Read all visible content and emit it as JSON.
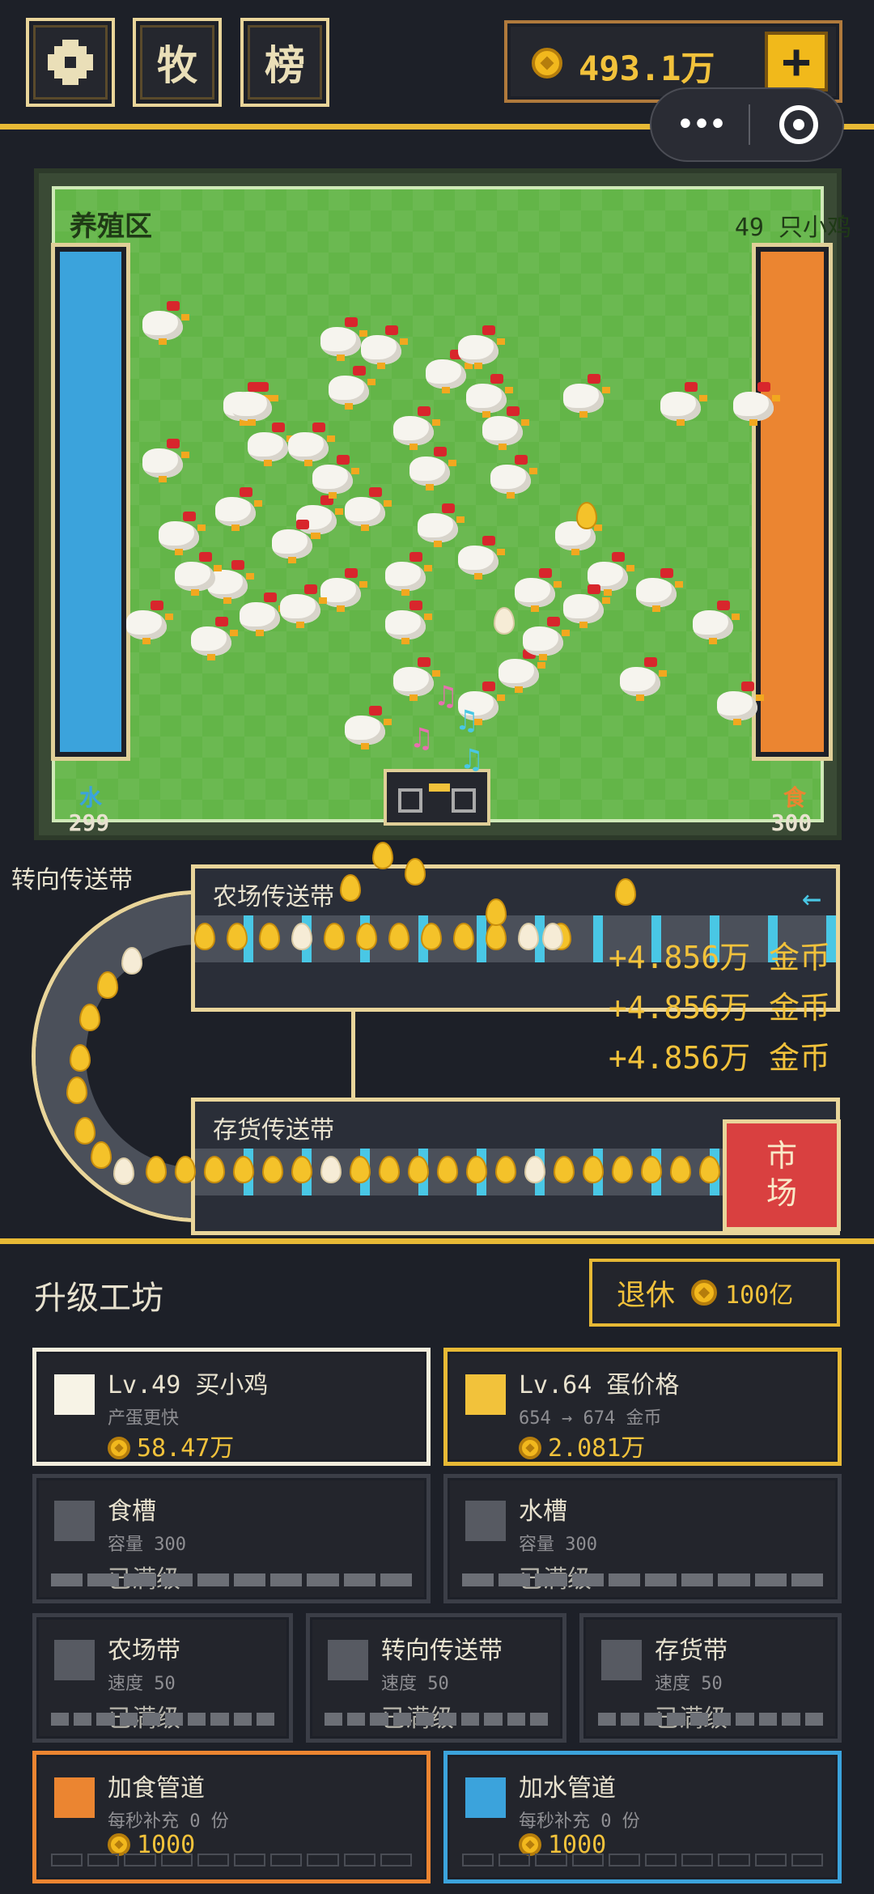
{
  "topbar": {
    "menu_icon": "gear-icon",
    "ranch_label": "牧",
    "rank_label": "榜",
    "coins": "493.1万",
    "add_label": "+",
    "capsule_more": "•••"
  },
  "farm": {
    "zone_label": "养殖区",
    "chick_count": "49 只小鸡",
    "water_label": "水",
    "water_value": "299",
    "food_label": "食",
    "food_value": "300",
    "water_level": 1.0,
    "food_level": 1.0
  },
  "conveyor": {
    "turn_label": "转向传送带",
    "farm_belt_label": "农场传送带",
    "stock_belt_label": "存货传送带",
    "direction_arrow": "←",
    "gains": [
      "+4.856万 金币",
      "+4.856万 金币",
      "+4.856万 金币"
    ],
    "market_label": "市\n场"
  },
  "shop": {
    "title": "升级工坊",
    "retire_label": "退休",
    "retire_cost": "100亿",
    "cards": {
      "buy_chick": {
        "name": "Lv.49 买小鸡",
        "desc": "产蛋更快",
        "price": "58.47万",
        "color": "#f7f3e6"
      },
      "egg_price": {
        "name": "Lv.64 蛋价格",
        "desc": "654 → 674 金币",
        "price": "2.081万",
        "color": "#f2c23b"
      },
      "feeder": {
        "name": "食槽",
        "desc": "容量 300",
        "status": "已满级"
      },
      "water": {
        "name": "水槽",
        "desc": "容量 300",
        "status": "已满级"
      },
      "farm_belt": {
        "name": "农场带",
        "desc": "速度 50",
        "status": "已满级"
      },
      "turn_belt": {
        "name": "转向传送带",
        "desc": "速度 50",
        "status": "已满级"
      },
      "stock_belt": {
        "name": "存货带",
        "desc": "速度 50",
        "status": "已满级"
      },
      "food_pipe": {
        "name": "加食管道",
        "desc": "每秒补充 0 份",
        "price": "1000",
        "color": "#eb8531"
      },
      "water_pipe": {
        "name": "加水管道",
        "desc": "每秒补充 0 份",
        "price": "1000",
        "color": "#3ba3dc"
      }
    }
  },
  "colors": {
    "accent": "#e7b935",
    "grass": "#63b548",
    "water": "#3ba3dc",
    "food": "#eb8531",
    "market": "#d94040",
    "belt_light": "#49c7e5"
  }
}
